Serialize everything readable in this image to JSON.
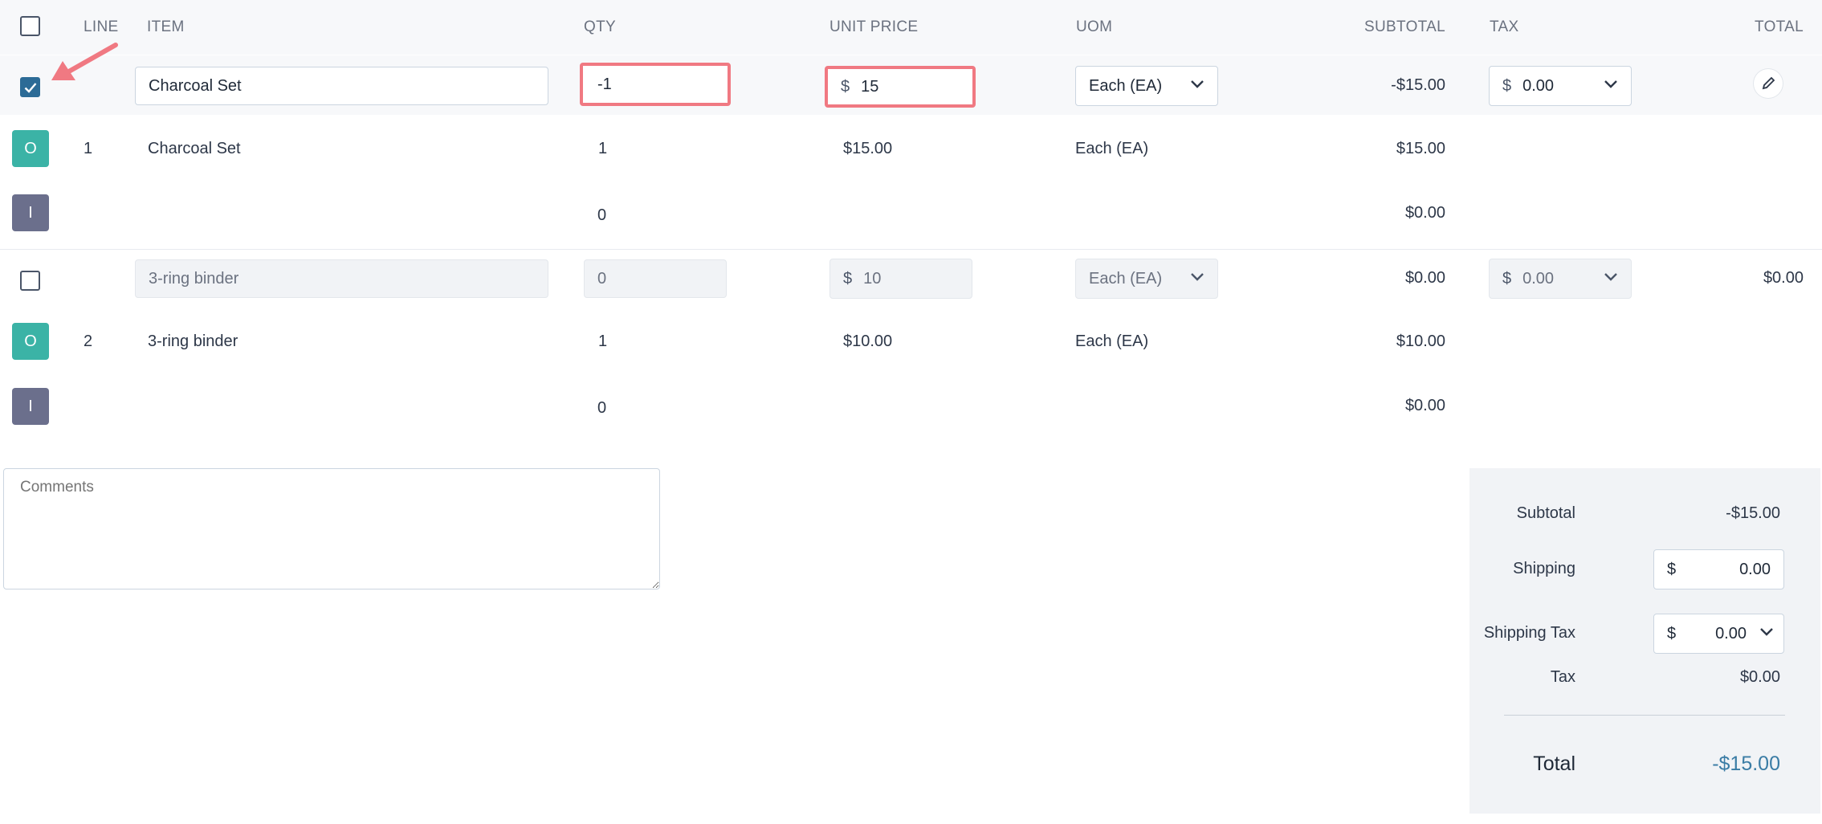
{
  "columns": {
    "line": "LINE",
    "item": "ITEM",
    "qty": "QTY",
    "unit_price": "UNIT PRICE",
    "uom": "UOM",
    "subtotal": "SUBTOTAL",
    "tax": "TAX",
    "total": "TOTAL"
  },
  "edit_row_1": {
    "checked": true,
    "item": "Charcoal Set",
    "qty": "-1",
    "currency": "$",
    "unit_price": "15",
    "uom": "Each (EA)",
    "subtotal": "-$15.00",
    "tax": "0.00"
  },
  "line_1": {
    "badge_o": "O",
    "badge_i": "I",
    "line": "1",
    "item": "Charcoal Set",
    "qty": "1",
    "unit_price": "$15.00",
    "uom": "Each (EA)",
    "subtotal": "$15.00",
    "i_qty": "0",
    "i_subtotal": "$0.00"
  },
  "edit_row_2": {
    "checked": false,
    "item": "3-ring binder",
    "qty": "0",
    "currency": "$",
    "unit_price": "10",
    "uom": "Each (EA)",
    "subtotal": "$0.00",
    "tax": "0.00",
    "total": "$0.00"
  },
  "line_2": {
    "badge_o": "O",
    "badge_i": "I",
    "line": "2",
    "item": "3-ring binder",
    "qty": "1",
    "unit_price": "$10.00",
    "uom": "Each (EA)",
    "subtotal": "$10.00",
    "i_qty": "0",
    "i_subtotal": "$0.00"
  },
  "comments": {
    "placeholder": "Comments"
  },
  "summary": {
    "subtotal_label": "Subtotal",
    "subtotal_value": "-$15.00",
    "shipping_label": "Shipping",
    "shipping_currency": "$",
    "shipping_value": "0.00",
    "shipping_tax_label": "Shipping Tax",
    "shipping_tax_currency": "$",
    "shipping_tax_value": "0.00",
    "tax_label": "Tax",
    "tax_value": "$0.00",
    "total_label": "Total",
    "total_value": "-$15.00"
  },
  "colors": {
    "accent": "#2c6b96",
    "highlight": "#f07982",
    "badge_o": "#3bb3a6",
    "badge_i": "#6b6f8c",
    "total_value": "#3a7ca5"
  }
}
